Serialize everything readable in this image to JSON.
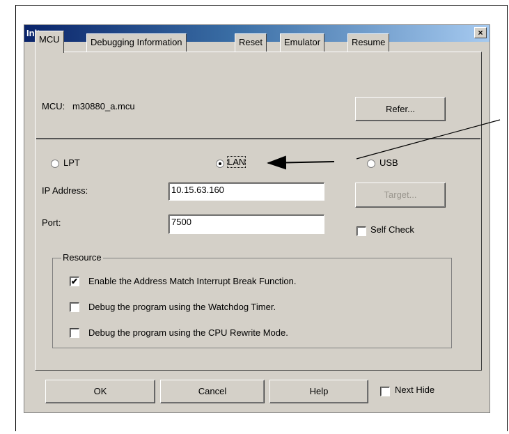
{
  "dialog": {
    "title": "Init",
    "close_glyph": "×"
  },
  "tabs": [
    {
      "label": "MCU",
      "active": true
    },
    {
      "label": "Debugging Information"
    },
    {
      "label": "Reset"
    },
    {
      "label": "Emulator"
    },
    {
      "label": "Resume"
    }
  ],
  "mcu": {
    "label": "MCU:",
    "value": "m30880_a.mcu",
    "refer_label": "Refer..."
  },
  "connection": {
    "options": [
      {
        "label": "LPT",
        "selected": false
      },
      {
        "label": "LAN",
        "selected": true
      },
      {
        "label": "USB",
        "selected": false
      }
    ],
    "ip_label": "IP Address:",
    "ip_value": "10.15.63.160",
    "port_label": "Port:",
    "port_value": "7500",
    "target_label": "Target...",
    "self_check_label": "Self Check",
    "self_check_checked": false
  },
  "resource": {
    "title": "Resource",
    "items": [
      {
        "label": "Enable the Address Match Interrupt Break Function.",
        "checked": true
      },
      {
        "label": "Debug the program using the Watchdog Timer.",
        "checked": false
      },
      {
        "label": "Debug the program using the CPU Rewrite Mode.",
        "checked": false
      }
    ]
  },
  "footer": {
    "ok_label": "OK",
    "cancel_label": "Cancel",
    "help_label": "Help",
    "next_hide_label": "Next Hide",
    "next_hide_checked": false
  },
  "check_glyph": "✔",
  "colors": {
    "dialog_bg": "#d4d0c8",
    "title_start": "#0a246a",
    "title_end": "#a6caf0"
  }
}
